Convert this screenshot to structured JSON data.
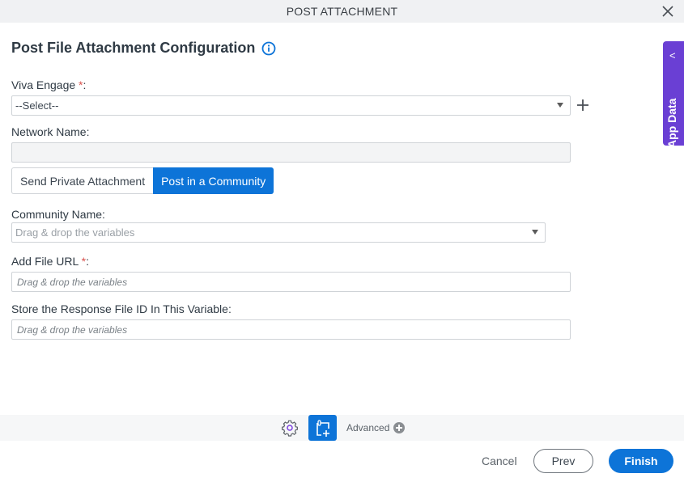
{
  "window": {
    "title": "POST ATTACHMENT",
    "close_icon": "close-icon"
  },
  "header": {
    "title": "Post File Attachment Configuration",
    "info_icon": "info-icon"
  },
  "form": {
    "viva_engage": {
      "label": "Viva Engage",
      "required_mark": "*",
      "suffix": ":",
      "value": "--Select--",
      "add_icon": "plus-icon"
    },
    "network_name": {
      "label": "Network Name:",
      "value": ""
    },
    "mode_toggle": {
      "options": [
        "Send Private Attachment",
        "Post in a Community"
      ],
      "selected": "Post in a Community"
    },
    "community_name": {
      "label": "Community Name:",
      "placeholder": "Drag & drop the variables"
    },
    "file_url": {
      "label": "Add File URL",
      "required_mark": "*",
      "suffix": ":",
      "placeholder": "Drag & drop the variables"
    },
    "response_file_id": {
      "label": "Store the Response File ID In This Variable:",
      "placeholder": "Drag & drop the variables"
    }
  },
  "side_panel": {
    "label": "App Data",
    "chevron": "<"
  },
  "toolbar": {
    "settings_icon": "gear-icon",
    "attachment_icon": "attachment-add-icon",
    "advanced_label": "Advanced"
  },
  "footer": {
    "cancel_label": "Cancel",
    "prev_label": "Prev",
    "finish_label": "Finish"
  },
  "colors": {
    "primary": "#0d74d8",
    "side_panel": "#6a3fd4",
    "required": "#d9534f"
  }
}
